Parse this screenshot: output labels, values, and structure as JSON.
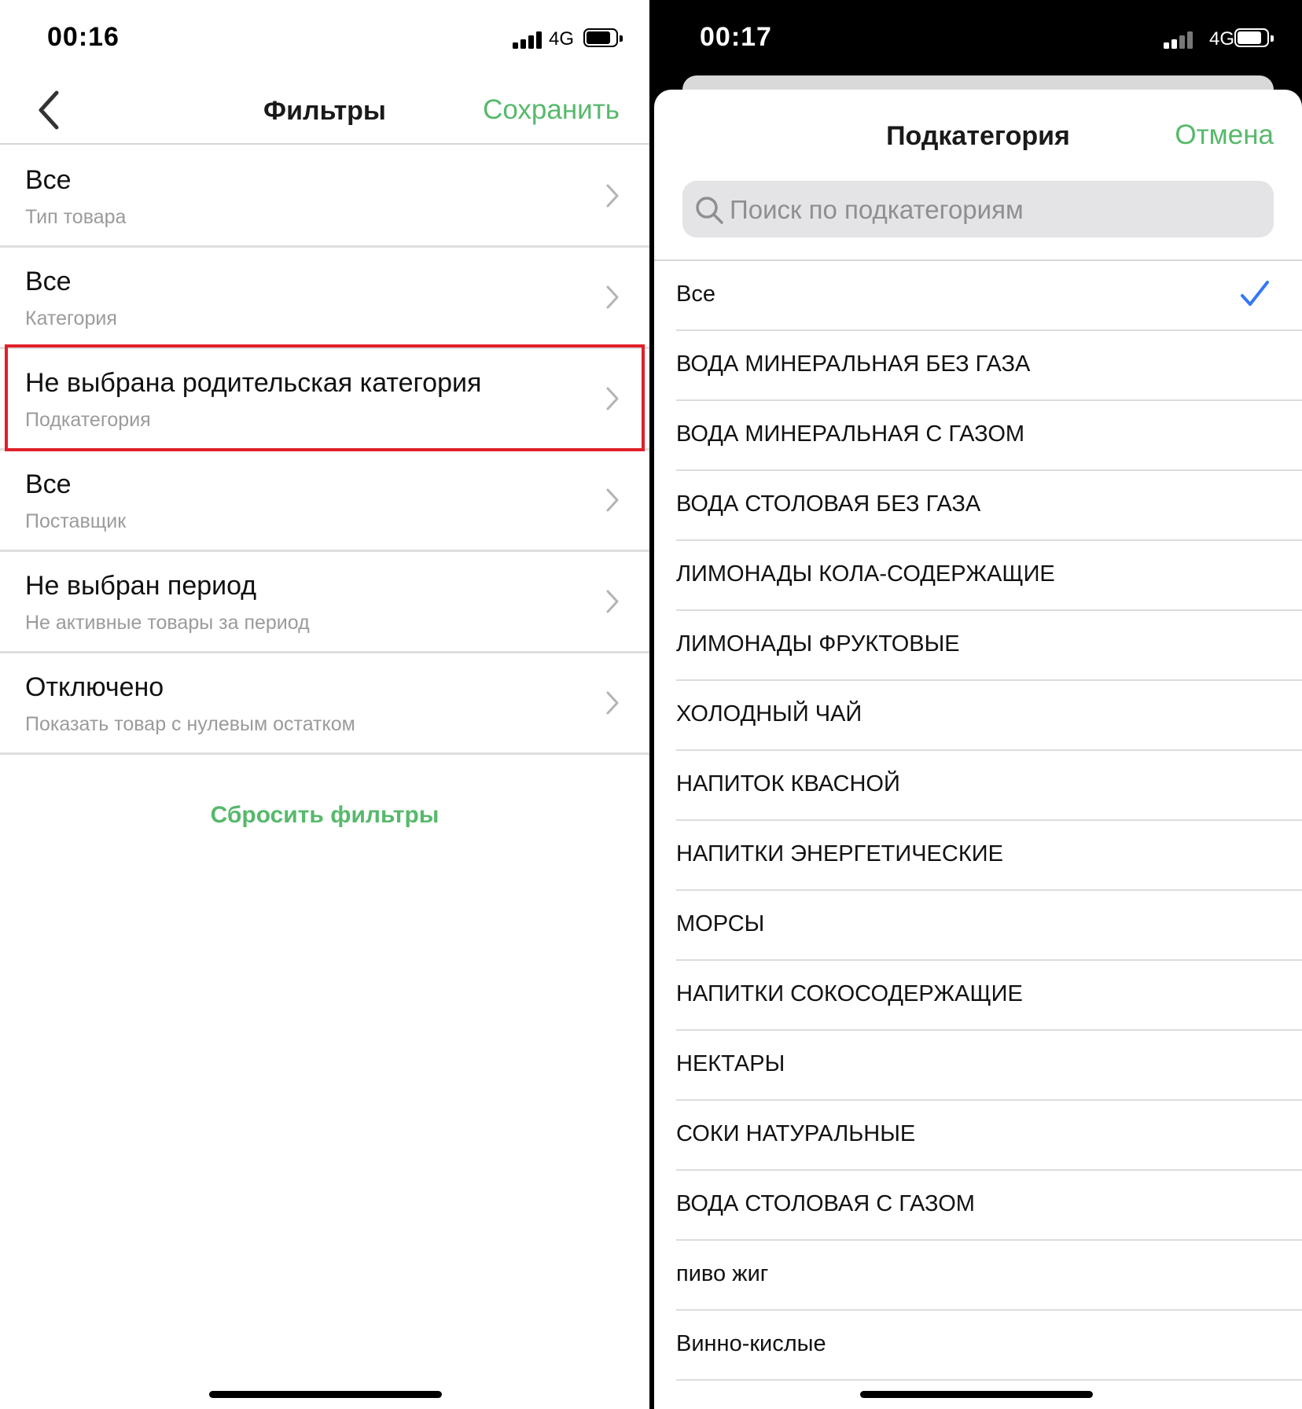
{
  "left": {
    "status": {
      "time": "00:16",
      "network": "4G"
    },
    "nav": {
      "title": "Фильтры",
      "save": "Сохранить"
    },
    "filters": [
      {
        "value": "Все",
        "label": "Тип товара"
      },
      {
        "value": "Все",
        "label": "Категория"
      },
      {
        "value": "Не выбрана родительская категория",
        "label": "Подкатегория"
      },
      {
        "value": "Все",
        "label": "Поставщик"
      },
      {
        "value": "Не выбран период",
        "label": "Не активные товары за период"
      },
      {
        "value": "Отключено",
        "label": "Показать товар с нулевым остатком"
      }
    ],
    "reset": "Сбросить фильтры"
  },
  "right": {
    "status": {
      "time": "00:17",
      "network": "4G"
    },
    "sheet": {
      "title": "Подкатегория",
      "cancel": "Отмена",
      "search_placeholder": "Поиск по подкатегориям"
    },
    "items": [
      "Все",
      "ВОДА МИНЕРАЛЬНАЯ БЕЗ ГАЗА",
      "ВОДА МИНЕРАЛЬНАЯ С ГАЗОМ",
      "ВОДА СТОЛОВАЯ БЕЗ ГАЗА",
      "ЛИМОНАДЫ КОЛА-СОДЕРЖАЩИЕ",
      "ЛИМОНАДЫ ФРУКТОВЫЕ",
      "ХОЛОДНЫЙ ЧАЙ",
      "НАПИТОК КВАСНОЙ",
      "НАПИТКИ ЭНЕРГЕТИЧЕСКИЕ",
      "МОРСЫ",
      "НАПИТКИ СОКОСОДЕРЖАЩИЕ",
      "НЕКТАРЫ",
      "СОКИ НАТУРАЛЬНЫЕ",
      "ВОДА СТОЛОВАЯ С ГАЗОМ",
      "пиво жиг",
      "Винно-кислые"
    ],
    "selected_item": "Все"
  },
  "colors": {
    "accent_green": "#57b96c",
    "highlight_red": "#e0202a",
    "check_blue": "#3478f6"
  }
}
